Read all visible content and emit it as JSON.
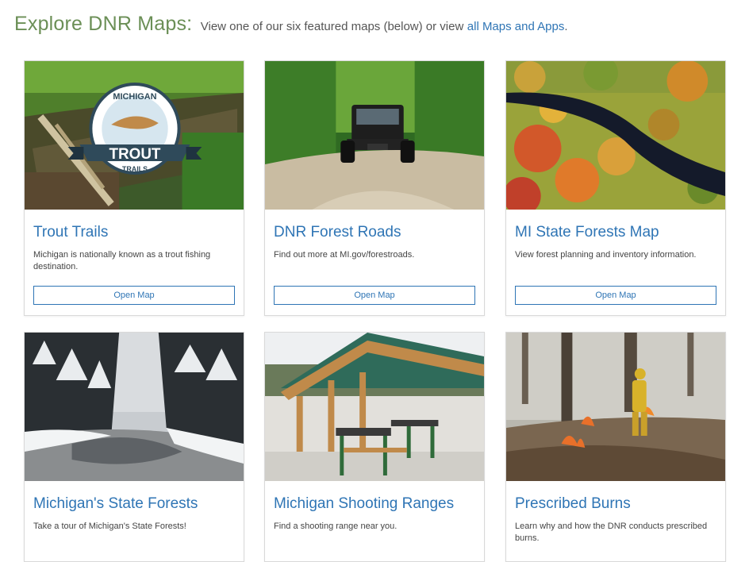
{
  "header": {
    "title": "Explore DNR Maps:",
    "intro": "View one of our six featured maps (below) or view",
    "link": "all Maps and Apps",
    "end": "."
  },
  "cards": [
    {
      "title": "Trout Trails",
      "desc": "Michigan is nationally known as a trout fishing destination.",
      "button": "Open Map",
      "logo": {
        "top": "MICHIGAN",
        "middle": "TROUT",
        "bottom": "TRAILS"
      }
    },
    {
      "title": "DNR Forest Roads",
      "desc": "Find out more at MI.gov/forestroads.",
      "button": "Open Map"
    },
    {
      "title": "MI State Forests Map",
      "desc": "View forest planning and inventory information.",
      "button": "Open Map"
    },
    {
      "title": "Michigan's State Forests",
      "desc": "Take a tour of Michigan's State Forests!"
    },
    {
      "title": "Michigan Shooting Ranges",
      "desc": "Find a shooting range near you."
    },
    {
      "title": "Prescribed Burns",
      "desc": "Learn why and how the DNR conducts prescribed burns."
    }
  ]
}
